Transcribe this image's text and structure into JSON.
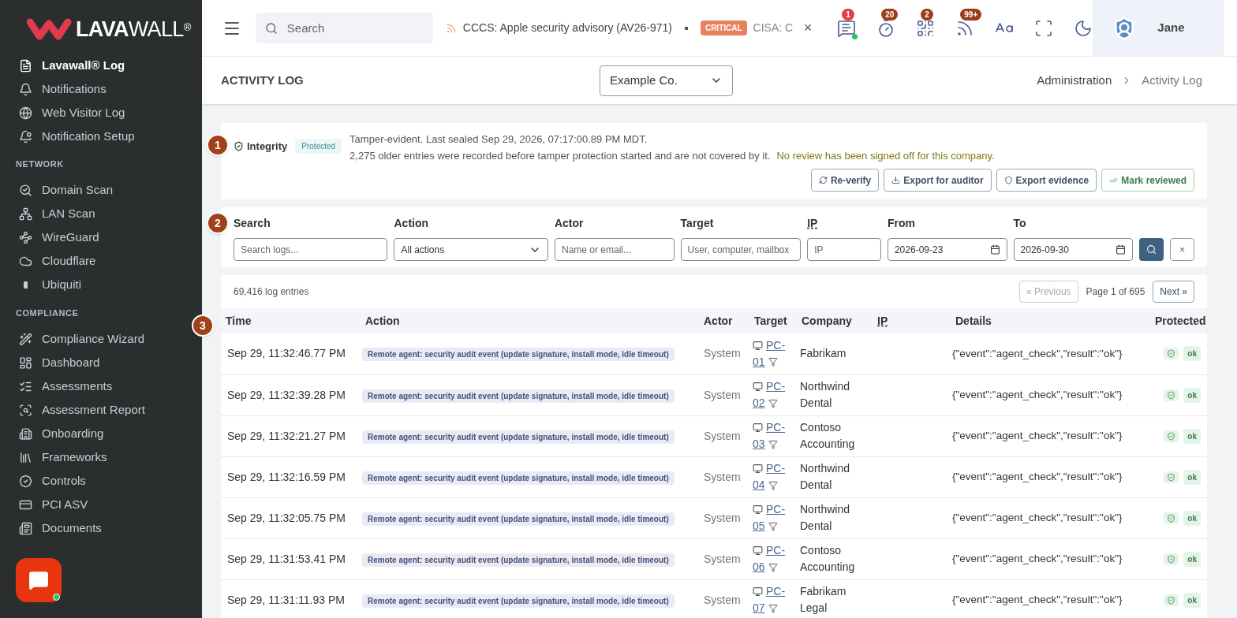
{
  "brand": {
    "name_bold": "LAVA",
    "name_light": "WALL",
    "mark": "®"
  },
  "sidebar": {
    "items": [
      {
        "label": "Lavawall® Log",
        "selected": true
      },
      {
        "label": "Notifications",
        "selected": false
      },
      {
        "label": "Web Visitor Log",
        "selected": false
      },
      {
        "label": "Notification Setup",
        "selected": false
      }
    ],
    "sections": [
      {
        "title": "NETWORK",
        "items": [
          {
            "label": "Domain Scan",
            "selected": false
          },
          {
            "label": "LAN Scan",
            "selected": false
          },
          {
            "label": "WireGuard",
            "selected": false
          },
          {
            "label": "Cloudflare",
            "selected": false
          },
          {
            "label": "Ubiquiti",
            "selected": false
          }
        ]
      },
      {
        "title": "COMPLIANCE",
        "items": [
          {
            "label": "Compliance Wizard",
            "selected": false
          },
          {
            "label": "Dashboard",
            "selected": false
          },
          {
            "label": "Assessments",
            "selected": false
          },
          {
            "label": "Assessment Report",
            "selected": false
          },
          {
            "label": "Onboarding",
            "selected": false
          },
          {
            "label": "Frameworks",
            "selected": false
          },
          {
            "label": "Controls",
            "selected": false
          },
          {
            "label": "PCI ASV",
            "selected": false
          },
          {
            "label": "Documents",
            "selected": false
          }
        ]
      }
    ]
  },
  "topbar": {
    "search_placeholder": "Search",
    "ticker": [
      {
        "text": "CCCS: Apple security advisory (AV26-971)"
      },
      {
        "badge": "CRITICAL",
        "text": "CISA: C"
      }
    ],
    "close": "×",
    "icons": [
      {
        "kind": "message",
        "badge": "1",
        "color": "#e53e3e",
        "online": true
      },
      {
        "kind": "timer",
        "badge": "20",
        "color": "#9c3d1c",
        "online": false
      },
      {
        "kind": "qr",
        "badge": "2",
        "color": "#9c3d1c",
        "online": false
      },
      {
        "kind": "rss",
        "badge": "99+",
        "color": "#9c3d1c",
        "online": false
      },
      {
        "kind": "font"
      },
      {
        "kind": "fullscreen"
      },
      {
        "kind": "moon"
      }
    ],
    "user": "Jane"
  },
  "header": {
    "title": "ACTIVITY LOG",
    "company": "Example Co.",
    "breadcrumb": [
      "Administration",
      "Activity Log"
    ]
  },
  "integrity": {
    "step": "1",
    "title": "Integrity",
    "status": "Protected",
    "line1": "Tamper-evident. Last sealed Sep 29, 2026, 07:17:00.89 PM MDT.",
    "line2": "2,275 older entries were recorded before tamper protection started and are not covered by it.",
    "warning": "No review has been signed off for this company.",
    "buttons": [
      {
        "label": "Re-verify"
      },
      {
        "label": "Export for auditor"
      },
      {
        "label": "Export evidence"
      },
      {
        "label": "Mark reviewed"
      }
    ]
  },
  "filters": {
    "step": "2",
    "fields": [
      {
        "label": "Search",
        "kind": "text",
        "placeholder": "Search logs..."
      },
      {
        "label": "Action",
        "kind": "select",
        "value": "All actions"
      },
      {
        "label": "Actor",
        "kind": "text",
        "placeholder": "Name or email..."
      },
      {
        "label": "Target",
        "kind": "text",
        "placeholder": "User, computer, mailbox"
      },
      {
        "label": "IP",
        "kind": "text",
        "placeholder": "IP"
      },
      {
        "label": "From",
        "kind": "date",
        "value": "2026-09-23"
      },
      {
        "label": "To",
        "kind": "date",
        "value": "2026-09-30"
      }
    ],
    "clear": "×"
  },
  "log": {
    "count": "69,416 log entries",
    "previous": "« Previous",
    "page": "Page 1 of 695",
    "next": "Next »",
    "step": "3",
    "columns": [
      "Time",
      "Action",
      "Actor",
      "Target",
      "Company",
      "IP",
      "Details",
      "Protected"
    ],
    "rows": [
      {
        "time": "Sep 29, 11:32:46.77 PM",
        "action": "Remote agent: security audit event (update signature, install mode, idle timeout)",
        "actor": "System",
        "target": [
          "PC-",
          "01"
        ],
        "company": "Fabrikam",
        "details": "{\"event\":\"agent_check\",\"result\":\"ok\"}",
        "protected": "ok"
      },
      {
        "time": "Sep 29, 11:32:39.28 PM",
        "action": "Remote agent: security audit event (update signature, install mode, idle timeout)",
        "actor": "System",
        "target": [
          "PC-",
          "02"
        ],
        "company": "Northwind Dental",
        "details": "{\"event\":\"agent_check\",\"result\":\"ok\"}",
        "protected": "ok"
      },
      {
        "time": "Sep 29, 11:32:21.27 PM",
        "action": "Remote agent: security audit event (update signature, install mode, idle timeout)",
        "actor": "System",
        "target": [
          "PC-",
          "03"
        ],
        "company": "Contoso Accounting",
        "details": "{\"event\":\"agent_check\",\"result\":\"ok\"}",
        "protected": "ok"
      },
      {
        "time": "Sep 29, 11:32:16.59 PM",
        "action": "Remote agent: security audit event (update signature, install mode, idle timeout)",
        "actor": "System",
        "target": [
          "PC-",
          "04"
        ],
        "company": "Northwind Dental",
        "details": "{\"event\":\"agent_check\",\"result\":\"ok\"}",
        "protected": "ok"
      },
      {
        "time": "Sep 29, 11:32:05.75 PM",
        "action": "Remote agent: security audit event (update signature, install mode, idle timeout)",
        "actor": "System",
        "target": [
          "PC-",
          "05"
        ],
        "company": "Northwind Dental",
        "details": "{\"event\":\"agent_check\",\"result\":\"ok\"}",
        "protected": "ok"
      },
      {
        "time": "Sep 29, 11:31:53.41 PM",
        "action": "Remote agent: security audit event (update signature, install mode, idle timeout)",
        "actor": "System",
        "target": [
          "PC-",
          "06"
        ],
        "company": "Contoso Accounting",
        "details": "{\"event\":\"agent_check\",\"result\":\"ok\"}",
        "protected": "ok"
      },
      {
        "time": "Sep 29, 11:31:11.93 PM",
        "action": "Remote agent: security audit event (update signature, install mode, idle timeout)",
        "actor": "System",
        "target": [
          "PC-",
          "07"
        ],
        "company": "Fabrikam Legal",
        "details": "{\"event\":\"agent_check\",\"result\":\"ok\"}",
        "protected": "ok"
      }
    ]
  }
}
